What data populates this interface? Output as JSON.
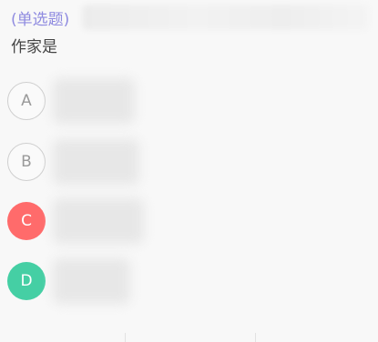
{
  "question": {
    "type_label": "(单选题)",
    "stem": "作家是"
  },
  "options": [
    {
      "letter": "A",
      "state": "unselected"
    },
    {
      "letter": "B",
      "state": "unselected"
    },
    {
      "letter": "C",
      "state": "wrong"
    },
    {
      "letter": "D",
      "state": "correct"
    }
  ],
  "colors": {
    "type_label": "#8f8be0",
    "wrong": "#ff6b6b",
    "correct": "#45cfa4",
    "unselected_border": "#cfcfcf"
  }
}
